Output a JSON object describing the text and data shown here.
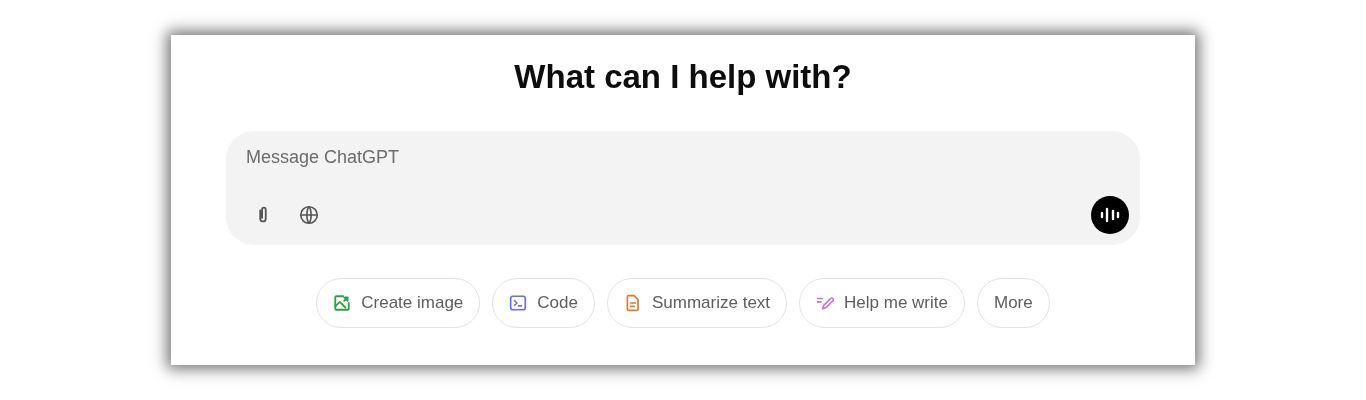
{
  "heading": "What can I help with?",
  "composer": {
    "placeholder": "Message ChatGPT"
  },
  "chips": [
    {
      "kind": "image",
      "label": "Create image"
    },
    {
      "kind": "code",
      "label": "Code"
    },
    {
      "kind": "summarize",
      "label": "Summarize text"
    },
    {
      "kind": "write",
      "label": "Help me write"
    },
    {
      "kind": "more",
      "label": "More"
    }
  ]
}
